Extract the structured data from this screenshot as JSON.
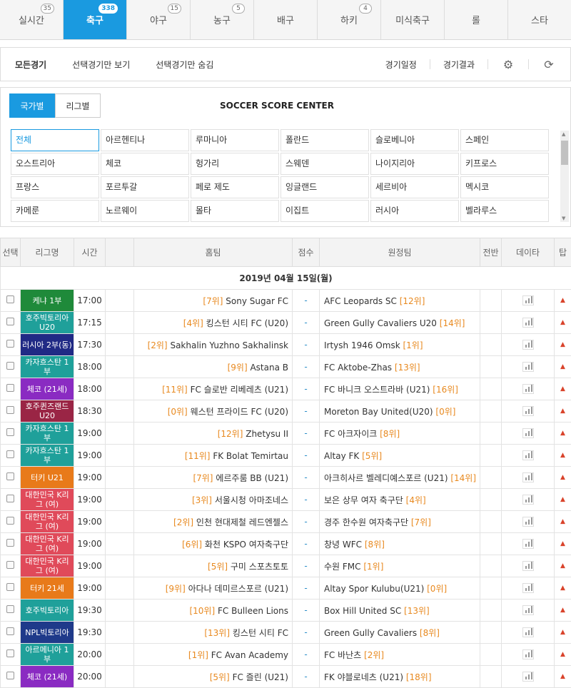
{
  "nav": [
    {
      "label": "실시간",
      "count": "35",
      "active": false
    },
    {
      "label": "축구",
      "count": "338",
      "active": true
    },
    {
      "label": "야구",
      "count": "15",
      "active": false
    },
    {
      "label": "농구",
      "count": "5",
      "active": false
    },
    {
      "label": "배구",
      "count": "",
      "active": false
    },
    {
      "label": "하키",
      "count": "4",
      "active": false
    },
    {
      "label": "미식축구",
      "count": "",
      "active": false
    },
    {
      "label": "롤",
      "count": "",
      "active": false
    },
    {
      "label": "스타",
      "count": "",
      "active": false
    }
  ],
  "filters": {
    "all": "모든경기",
    "show_selected": "선택경기만 보기",
    "hide_selected": "선택경기만 숨김",
    "schedule": "경기일정",
    "results": "경기결과"
  },
  "panel": {
    "tab_country": "국가별",
    "tab_league": "리그별",
    "title": "SOCCER SCORE CENTER",
    "countries": [
      "전체",
      "아르헨티나",
      "루마니아",
      "폴란드",
      "슬로베니아",
      "스페인",
      "오스트리아",
      "체코",
      "헝가리",
      "스웨덴",
      "나이지리아",
      "키프로스",
      "프랑스",
      "포르투갈",
      "페로 제도",
      "잉글랜드",
      "세르비아",
      "멕시코",
      "카메룬",
      "노르웨이",
      "몰타",
      "이집트",
      "러시아",
      "벨라루스"
    ]
  },
  "table": {
    "headers": [
      "선택",
      "리그명",
      "시간",
      "",
      "홈팀",
      "점수",
      "원정팀",
      "전반",
      "데이타",
      "탑"
    ],
    "date": "2019년 04월 15일(월)"
  },
  "colors": {
    "accent": "#1a9ae0",
    "rank": "#e8891f",
    "up": "#d9432b"
  },
  "matches": [
    {
      "league": "케냐 1부",
      "color": "#1f8a3a",
      "time": "17:00",
      "home_rank": "[7위]",
      "home": "Sony Sugar FC",
      "score": "-",
      "away": "AFC Leopards SC",
      "away_rank": "[12위]"
    },
    {
      "league": "호주빅토리아 U20",
      "color": "#1fa09a",
      "time": "17:15",
      "home_rank": "[4위]",
      "home": "킹스턴 시티 FC (U20)",
      "score": "-",
      "away": "Green Gully Cavaliers U20",
      "away_rank": "[14위]"
    },
    {
      "league": "러시아 2부(동)",
      "color": "#202a85",
      "time": "17:30",
      "home_rank": "[2위]",
      "home": "Sakhalin Yuzhno Sakhalinsk",
      "score": "-",
      "away": "Irtysh 1946 Omsk",
      "away_rank": "[1위]"
    },
    {
      "league": "카자흐스탄 1부",
      "color": "#1fa09a",
      "time": "18:00",
      "home_rank": "[9위]",
      "home": "Astana B",
      "score": "-",
      "away": "FC Aktobe-Zhas",
      "away_rank": "[13위]"
    },
    {
      "league": "체코 (21세)",
      "color": "#8a2bc2",
      "time": "18:00",
      "home_rank": "[11위]",
      "home": "FC 슬로반 리베레츠 (U21)",
      "score": "-",
      "away": "FC 바니크 오스트라바 (U21)",
      "away_rank": "[16위]"
    },
    {
      "league": "호주퀸즈랜드 U20",
      "color": "#9a2545",
      "time": "18:30",
      "home_rank": "[0위]",
      "home": "웨스턴 프라이드 FC (U20)",
      "score": "-",
      "away": "Moreton Bay United(U20)",
      "away_rank": "[0위]"
    },
    {
      "league": "카자흐스탄 1부",
      "color": "#1fa09a",
      "time": "19:00",
      "home_rank": "[12위]",
      "home": "Zhetysu II",
      "score": "-",
      "away": "FC 아크자이크",
      "away_rank": "[8위]"
    },
    {
      "league": "카자흐스탄 1부",
      "color": "#1fa09a",
      "time": "19:00",
      "home_rank": "[11위]",
      "home": "FK Bolat Temirtau",
      "score": "-",
      "away": "Altay FK",
      "away_rank": "[5위]"
    },
    {
      "league": "터키 U21",
      "color": "#e87a1a",
      "time": "19:00",
      "home_rank": "[7위]",
      "home": "에르주룸 BB (U21)",
      "score": "-",
      "away": "아크히사르 벨레디예스포르 (U21)",
      "away_rank": "[14위]"
    },
    {
      "league": "대한민국 K리그 (여)",
      "color": "#e04a5a",
      "time": "19:00",
      "home_rank": "[3위]",
      "home": "서울시청 아마조네스",
      "score": "-",
      "away": "보은 상무 여자 축구단",
      "away_rank": "[4위]"
    },
    {
      "league": "대한민국 K리그 (여)",
      "color": "#e04a5a",
      "time": "19:00",
      "home_rank": "[2위]",
      "home": "인천 현대제철 레드엔젤스",
      "score": "-",
      "away": "경주 한수원 여자축구단",
      "away_rank": "[7위]"
    },
    {
      "league": "대한민국 K리그 (여)",
      "color": "#e04a5a",
      "time": "19:00",
      "home_rank": "[6위]",
      "home": "화천 KSPO 여자축구단",
      "score": "-",
      "away": "창녕 WFC",
      "away_rank": "[8위]"
    },
    {
      "league": "대한민국 K리그 (여)",
      "color": "#e04a5a",
      "time": "19:00",
      "home_rank": "[5위]",
      "home": "구미 스포츠토토",
      "score": "-",
      "away": "수원 FMC",
      "away_rank": "[1위]"
    },
    {
      "league": "터키 21세",
      "color": "#e87a1a",
      "time": "19:00",
      "home_rank": "[9위]",
      "home": "아다나 데미르스포르 (U21)",
      "score": "-",
      "away": "Altay Spor Kulubu(U21)",
      "away_rank": "[0위]"
    },
    {
      "league": "호주빅토리아",
      "color": "#1fa09a",
      "time": "19:30",
      "home_rank": "[10위]",
      "home": "FC Bulleen Lions",
      "score": "-",
      "away": "Box Hill United SC",
      "away_rank": "[13위]"
    },
    {
      "league": "NPL빅토리아",
      "color": "#1f3a8a",
      "time": "19:30",
      "home_rank": "[13위]",
      "home": "킹스턴 시티 FC",
      "score": "-",
      "away": "Green Gully Cavaliers",
      "away_rank": "[8위]"
    },
    {
      "league": "아르메니아 1부",
      "color": "#1fa09a",
      "time": "20:00",
      "home_rank": "[1위]",
      "home": "FC Avan Academy",
      "score": "-",
      "away": "FC 바난츠",
      "away_rank": "[2위]"
    },
    {
      "league": "체코 (21세)",
      "color": "#8a2bc2",
      "time": "20:00",
      "home_rank": "[5위]",
      "home": "FC 즐린 (U21)",
      "score": "-",
      "away": "FK 야블로네츠 (U21)",
      "away_rank": "[18위]"
    }
  ]
}
